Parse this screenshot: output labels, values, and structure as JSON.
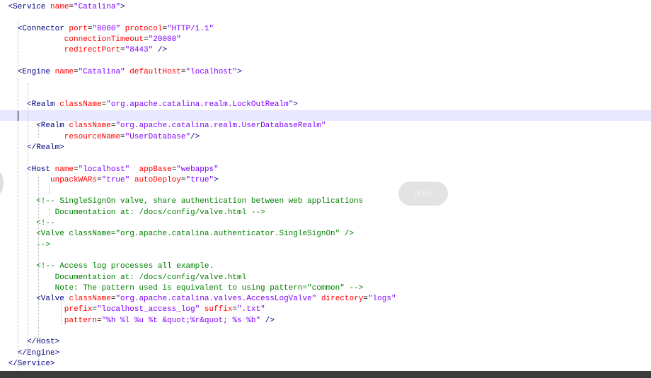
{
  "editor": {
    "zoom_label": "90%",
    "colors": {
      "tag": "#000080",
      "attr": "#ff0000",
      "string": "#8000ff",
      "comment": "#008000",
      "current_line": "#e8e8ff",
      "status_bar": "#3c3c3c"
    },
    "lines": [
      {
        "indent": 1,
        "tokens": [
          [
            "tag",
            "<Service"
          ],
          [
            "txt",
            " "
          ],
          [
            "attr",
            "name"
          ],
          [
            "eq",
            "="
          ],
          [
            "str",
            "\"Catalina\""
          ],
          [
            "tag",
            ">"
          ]
        ]
      },
      {
        "indent": 0,
        "tokens": []
      },
      {
        "indent": 3,
        "tokens": [
          [
            "tag",
            "<Connector"
          ],
          [
            "txt",
            " "
          ],
          [
            "attr",
            "port"
          ],
          [
            "eq",
            "="
          ],
          [
            "str",
            "\"8080\""
          ],
          [
            "txt",
            " "
          ],
          [
            "attr",
            "protocol"
          ],
          [
            "eq",
            "="
          ],
          [
            "str",
            "\"HTTP/1.1\""
          ]
        ]
      },
      {
        "indent": 13,
        "tokens": [
          [
            "attr",
            "connectionTimeout"
          ],
          [
            "eq",
            "="
          ],
          [
            "str",
            "\"20000\""
          ]
        ]
      },
      {
        "indent": 13,
        "tokens": [
          [
            "attr",
            "redirectPort"
          ],
          [
            "eq",
            "="
          ],
          [
            "str",
            "\"8443\""
          ],
          [
            "txt",
            " "
          ],
          [
            "tag",
            "/>"
          ]
        ]
      },
      {
        "indent": 0,
        "tokens": []
      },
      {
        "indent": 3,
        "tokens": [
          [
            "tag",
            "<Engine"
          ],
          [
            "txt",
            " "
          ],
          [
            "attr",
            "name"
          ],
          [
            "eq",
            "="
          ],
          [
            "str",
            "\"Catalina\""
          ],
          [
            "txt",
            " "
          ],
          [
            "attr",
            "defaultHost"
          ],
          [
            "eq",
            "="
          ],
          [
            "str",
            "\"localhost\""
          ],
          [
            "tag",
            ">"
          ]
        ]
      },
      {
        "indent": 0,
        "tokens": []
      },
      {
        "indent": 0,
        "tokens": []
      },
      {
        "indent": 5,
        "tokens": [
          [
            "tag",
            "<Realm"
          ],
          [
            "txt",
            " "
          ],
          [
            "attr",
            "className"
          ],
          [
            "eq",
            "="
          ],
          [
            "str",
            "\"org.apache.catalina.realm.LockOutRealm\""
          ],
          [
            "tag",
            ">"
          ]
        ]
      },
      {
        "indent": 0,
        "tokens": [],
        "current": true
      },
      {
        "indent": 7,
        "tokens": [
          [
            "tag",
            "<Realm"
          ],
          [
            "txt",
            " "
          ],
          [
            "attr",
            "className"
          ],
          [
            "eq",
            "="
          ],
          [
            "str",
            "\"org.apache.catalina.realm.UserDatabaseRealm\""
          ]
        ]
      },
      {
        "indent": 13,
        "tokens": [
          [
            "attr",
            "resourceName"
          ],
          [
            "eq",
            "="
          ],
          [
            "str",
            "\"UserDatabase\""
          ],
          [
            "tag",
            "/>"
          ]
        ]
      },
      {
        "indent": 5,
        "tokens": [
          [
            "tag",
            "</Realm>"
          ]
        ]
      },
      {
        "indent": 0,
        "tokens": []
      },
      {
        "indent": 5,
        "tokens": [
          [
            "tag",
            "<Host"
          ],
          [
            "txt",
            " "
          ],
          [
            "attr",
            "name"
          ],
          [
            "eq",
            "="
          ],
          [
            "str",
            "\"localhost\""
          ],
          [
            "txt",
            "  "
          ],
          [
            "attr",
            "appBase"
          ],
          [
            "eq",
            "="
          ],
          [
            "str",
            "\"webapps\""
          ]
        ]
      },
      {
        "indent": 10,
        "tokens": [
          [
            "attr",
            "unpackWARs"
          ],
          [
            "eq",
            "="
          ],
          [
            "str",
            "\"true\""
          ],
          [
            "txt",
            " "
          ],
          [
            "attr",
            "autoDeploy"
          ],
          [
            "eq",
            "="
          ],
          [
            "str",
            "\"true\""
          ],
          [
            "tag",
            ">"
          ]
        ]
      },
      {
        "indent": 0,
        "tokens": []
      },
      {
        "indent": 7,
        "tokens": [
          [
            "cmt",
            "<!-- SingleSignOn valve, share authentication between web applications"
          ]
        ]
      },
      {
        "indent": 11,
        "tokens": [
          [
            "cmt",
            "Documentation at: /docs/config/valve.html -->"
          ]
        ]
      },
      {
        "indent": 7,
        "tokens": [
          [
            "cmt",
            "<!--"
          ]
        ]
      },
      {
        "indent": 7,
        "tokens": [
          [
            "cmt",
            "<Valve className=\"org.apache.catalina.authenticator.SingleSignOn\" />"
          ]
        ]
      },
      {
        "indent": 7,
        "tokens": [
          [
            "cmt",
            "-->"
          ]
        ]
      },
      {
        "indent": 0,
        "tokens": []
      },
      {
        "indent": 7,
        "tokens": [
          [
            "cmt",
            "<!-- Access log processes all example."
          ]
        ]
      },
      {
        "indent": 11,
        "tokens": [
          [
            "cmt",
            "Documentation at: /docs/config/valve.html"
          ]
        ]
      },
      {
        "indent": 11,
        "tokens": [
          [
            "cmt",
            "Note: The pattern used is equivalent to using pattern=\"common\" -->"
          ]
        ]
      },
      {
        "indent": 7,
        "tokens": [
          [
            "tag",
            "<Valve"
          ],
          [
            "txt",
            " "
          ],
          [
            "attr",
            "className"
          ],
          [
            "eq",
            "="
          ],
          [
            "str",
            "\"org.apache.catalina.valves.AccessLogValve\""
          ],
          [
            "txt",
            " "
          ],
          [
            "attr",
            "directory"
          ],
          [
            "eq",
            "="
          ],
          [
            "str",
            "\"logs\""
          ]
        ]
      },
      {
        "indent": 13,
        "tokens": [
          [
            "attr",
            "prefix"
          ],
          [
            "eq",
            "="
          ],
          [
            "str",
            "\"localhost_access_log\""
          ],
          [
            "txt",
            " "
          ],
          [
            "attr",
            "suffix"
          ],
          [
            "eq",
            "="
          ],
          [
            "str",
            "\".txt\""
          ]
        ]
      },
      {
        "indent": 13,
        "tokens": [
          [
            "attr",
            "pattern"
          ],
          [
            "eq",
            "="
          ],
          [
            "str",
            "\"%h %l %u %t &quot;%r&quot; %s %b\""
          ],
          [
            "txt",
            " "
          ],
          [
            "tag",
            "/>"
          ]
        ]
      },
      {
        "indent": 0,
        "tokens": []
      },
      {
        "indent": 5,
        "tokens": [
          [
            "tag",
            "</Host>"
          ]
        ]
      },
      {
        "indent": 3,
        "tokens": [
          [
            "tag",
            "</Engine>"
          ]
        ]
      },
      {
        "indent": 1,
        "tokens": [
          [
            "tag",
            "</Service>"
          ]
        ]
      }
    ]
  }
}
